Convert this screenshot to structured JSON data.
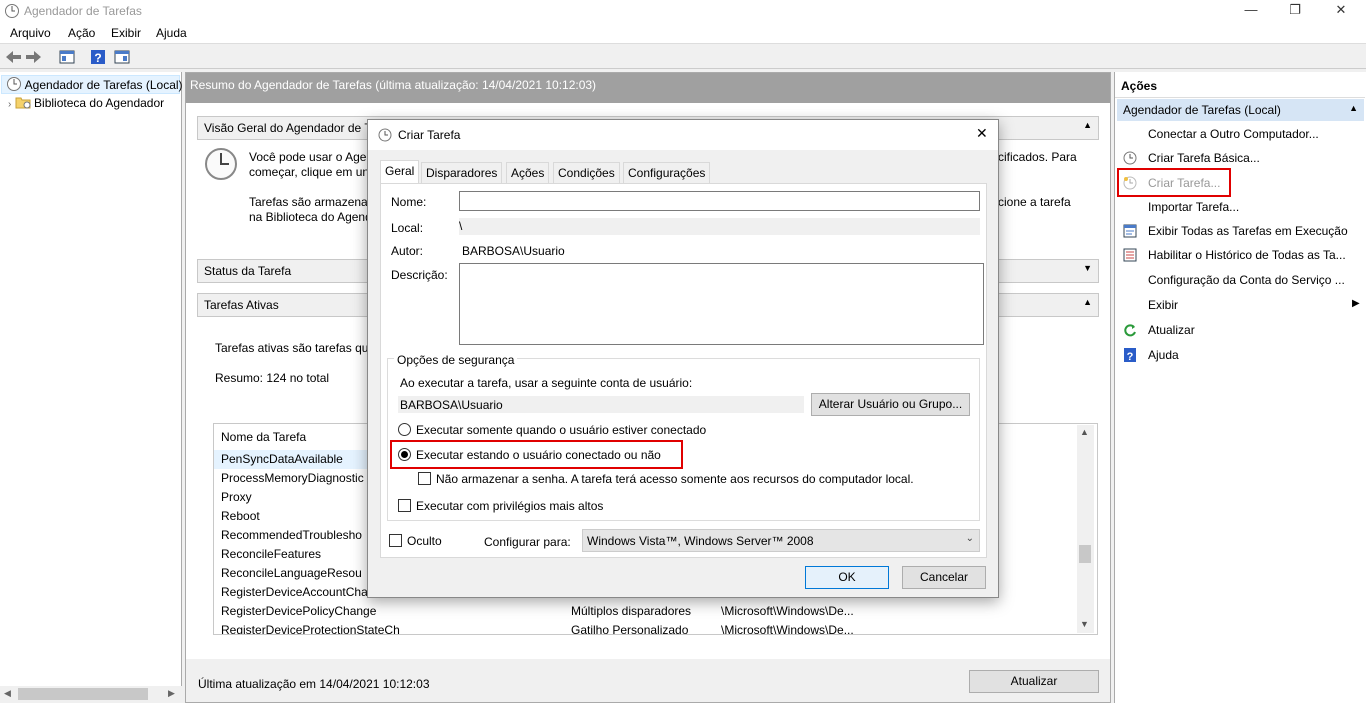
{
  "window": {
    "title": "Agendador de Tarefas",
    "minimize": "—",
    "restore": "❐",
    "close": "✕"
  },
  "menu": [
    "Arquivo",
    "Ação",
    "Exibir",
    "Ajuda"
  ],
  "tree": {
    "root": "Agendador de Tarefas (Local)",
    "child": "Biblioteca do Agendador"
  },
  "main": {
    "header": "Resumo do Agendador de Tarefas (última atualização: 14/04/2021 10:12:03)",
    "overview_title": "Visão Geral do Agendador de Ta",
    "overview_text1a": "Você pode usar o Agen",
    "overview_text1b": "começar, clique em un",
    "overview_text1c": "cificados. Para",
    "overview_text2a": "Tarefas são armazenad",
    "overview_text2b": "na Biblioteca do Agend",
    "overview_text2c": "cione a tarefa",
    "status_title": "Status da Tarefa",
    "active_title": "Tarefas Ativas",
    "active_text": "Tarefas ativas são tarefas qu",
    "summary": "Resumo: 124 no total",
    "table_header": "Nome da Tarefa",
    "rows": [
      {
        "name": "PenSyncDataAvailable",
        "trigger": "",
        "path": ""
      },
      {
        "name": "ProcessMemoryDiagnostic",
        "trigger": "",
        "path": ""
      },
      {
        "name": "Proxy",
        "trigger": "",
        "path": ""
      },
      {
        "name": "Reboot",
        "trigger": "",
        "path": ""
      },
      {
        "name": "RecommendedTroublesho",
        "trigger": "",
        "path": ""
      },
      {
        "name": "ReconcileFeatures",
        "trigger": "",
        "path": ""
      },
      {
        "name": "ReconcileLanguageResou",
        "trigger": "",
        "path": ""
      },
      {
        "name": "RegisterDeviceAccountCha",
        "trigger": "",
        "path": ""
      },
      {
        "name": "RegisterDevicePolicyChange",
        "trigger": "Múltiplos disparadores",
        "path": "\\Microsoft\\Windows\\De..."
      },
      {
        "name": "RegisterDeviceProtectionStateCh",
        "trigger": "Gatilho Personalizado",
        "path": "\\Microsoft\\Windows\\De..."
      }
    ],
    "last_update": "Última atualização em 14/04/2021 10:12:03",
    "refresh_button": "Atualizar"
  },
  "actions": {
    "title": "Ações",
    "group": "Agendador de Tarefas (Local)",
    "items": [
      "Conectar a Outro Computador...",
      "Criar Tarefa Básica...",
      "Criar Tarefa...",
      "Importar Tarefa...",
      "Exibir Todas as Tarefas em Execução",
      "Habilitar o Histórico de Todas as Ta...",
      "Configuração da Conta do Serviço ...",
      "Exibir",
      "Atualizar",
      "Ajuda"
    ]
  },
  "dialog": {
    "title": "Criar Tarefa",
    "tabs": [
      "Geral",
      "Disparadores",
      "Ações",
      "Condições",
      "Configurações"
    ],
    "name_label": "Nome:",
    "name_value": "",
    "location_label": "Local:",
    "location_value": "\\",
    "author_label": "Autor:",
    "author_value": "BARBOSA\\Usuario",
    "description_label": "Descrição:",
    "security_group": "Opções de segurança",
    "account_text": "Ao executar a tarefa, usar a seguinte conta de usuário:",
    "account_value": "BARBOSA\\Usuario",
    "change_user_button": "Alterar Usuário ou Grupo...",
    "radio1": "Executar somente quando o usuário estiver conectado",
    "radio2": "Executar estando o usuário conectado ou não",
    "no_password": "Não armazenar a senha. A tarefa terá acesso somente aos recursos do computador local.",
    "highest_priv": "Executar com privilégios mais altos",
    "hidden": "Oculto",
    "configure_label": "Configurar para:",
    "configure_value": "Windows Vista™, Windows Server™ 2008",
    "ok": "OK",
    "cancel": "Cancelar"
  },
  "colors": {
    "highlight": "#e00000",
    "header_gray": "#a0a0a0",
    "actions_group": "#d6e5f5"
  }
}
